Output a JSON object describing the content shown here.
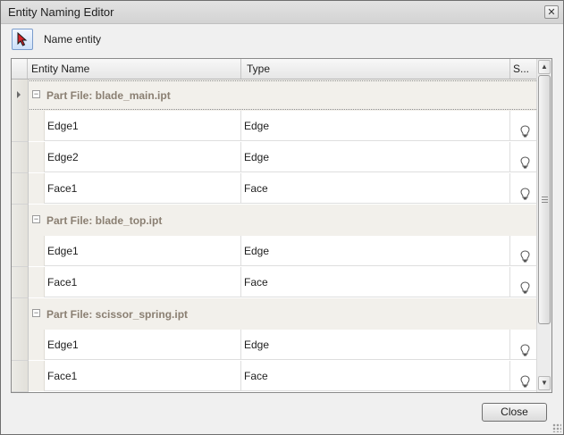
{
  "window": {
    "title": "Entity Naming Editor",
    "close_glyph": "✕"
  },
  "toolbar": {
    "pick_icon": "pointer-arrow-icon",
    "label": "Name entity"
  },
  "grid": {
    "columns": [
      "Entity Name",
      "Type",
      "S..."
    ],
    "groups": [
      {
        "title": "Part File: blade_main.ipt",
        "rows": [
          {
            "name": "Edge1",
            "type": "Edge",
            "icon": "lightbulb-icon"
          },
          {
            "name": "Edge2",
            "type": "Edge",
            "icon": "lightbulb-icon"
          },
          {
            "name": "Face1",
            "type": "Face",
            "icon": "lightbulb-icon"
          }
        ]
      },
      {
        "title": "Part File: blade_top.ipt",
        "rows": [
          {
            "name": "Edge1",
            "type": "Edge",
            "icon": "lightbulb-icon"
          },
          {
            "name": "Face1",
            "type": "Face",
            "icon": "lightbulb-icon"
          }
        ]
      },
      {
        "title": "Part File: scissor_spring.ipt",
        "rows": [
          {
            "name": "Edge1",
            "type": "Edge",
            "icon": "lightbulb-icon"
          },
          {
            "name": "Face1",
            "type": "Face",
            "icon": "lightbulb-icon"
          }
        ]
      }
    ],
    "collapse_glyph": "−",
    "scroll_up_glyph": "▲",
    "scroll_down_glyph": "▼"
  },
  "footer": {
    "close_label": "Close"
  }
}
